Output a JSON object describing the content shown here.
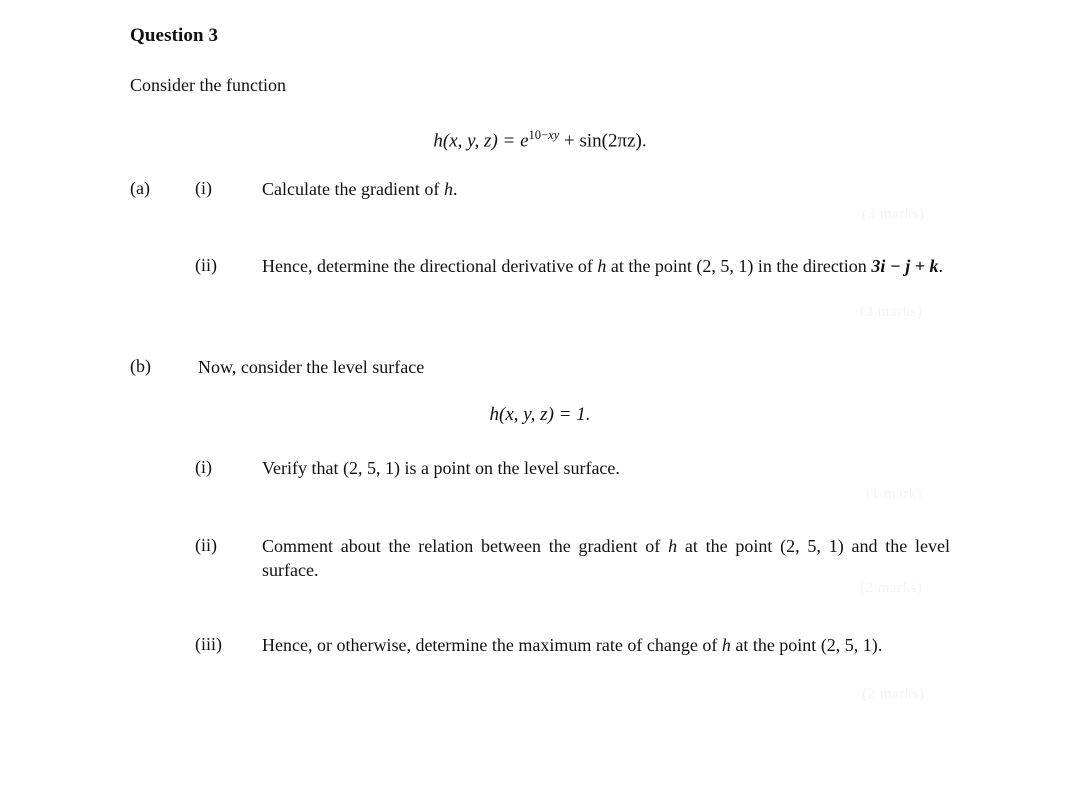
{
  "document": {
    "question_title": "Question 3",
    "intro": "Consider the function",
    "equations": {
      "main_function_lhs": "h(x, y, z) = e",
      "main_function_exp_base": "10−",
      "main_function_exp_vars": "xy",
      "main_function_rhs": "+ sin(2πz).",
      "level_surface": "h(x, y, z) = 1."
    },
    "parts": [
      {
        "label": "(a)",
        "intro": "",
        "subparts": [
          {
            "label": "(i)",
            "text": "Calculate the gradient of ",
            "math_tail": "h",
            "text_end": "."
          },
          {
            "label": "(ii)",
            "text_1": "Hence, determine the directional derivative of ",
            "math_1": "h",
            "text_2": " at the point ",
            "math_2": "(2, 5, 1)",
            "text_3": " in the direction ",
            "vector": "3i − j + k",
            "text_4": "."
          }
        ]
      },
      {
        "label": "(b)",
        "intro": "Now, consider the level surface",
        "subparts": [
          {
            "label": "(i)",
            "text_1": "Verify that ",
            "math_1": "(2, 5, 1)",
            "text_2": " is a point on the level surface."
          },
          {
            "label": "(ii)",
            "text_1": "Comment about the relation between the gradient of ",
            "math_1": "h",
            "text_2": " at the point ",
            "math_2": "(2, 5, 1)",
            "text_3": " and the level surface."
          },
          {
            "label": "(iii)",
            "text_1": "Hence, or otherwise, determine the maximum rate of change of ",
            "math_1": "h",
            "text_2": " at the point ",
            "math_2": "(2, 5, 1)",
            "text_3": "."
          }
        ]
      }
    ],
    "mark_allocations": [
      {
        "text": "(3 marks)"
      },
      {
        "text": "(3 marks)"
      },
      {
        "text": "(1 mark)"
      },
      {
        "text": "(2 marks)"
      },
      {
        "text": "(2 marks)"
      }
    ]
  },
  "colors": {
    "page_background": "#ffffff",
    "text": "#111111"
  }
}
